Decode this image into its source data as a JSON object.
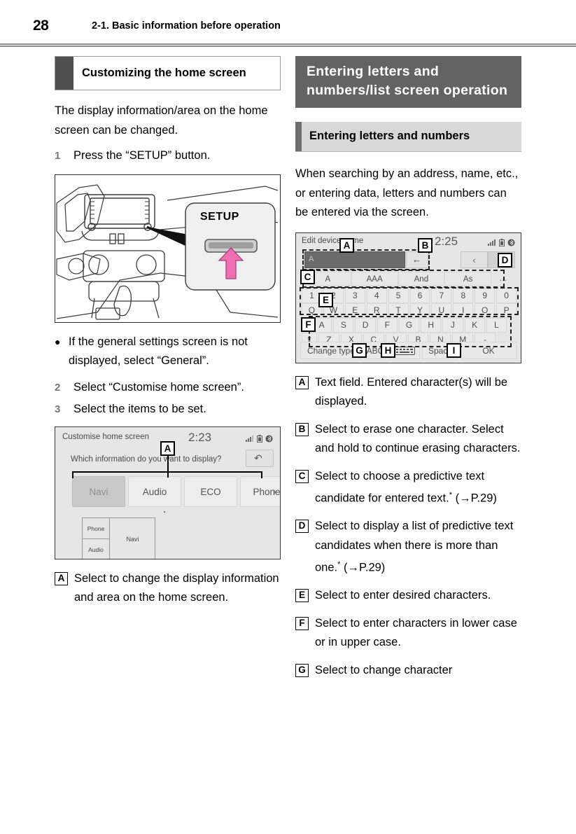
{
  "header": {
    "page_number": "28",
    "breadcrumb": "2-1. Basic information before operation"
  },
  "left_column": {
    "topic_heading": "Customizing the home screen",
    "intro": "The display information/area on the home screen can be changed.",
    "steps": [
      {
        "num": "1",
        "text": "Press the “SETUP” button."
      },
      {
        "num": "2",
        "text": "Select “Customise home screen”."
      },
      {
        "num": "3",
        "text": "Select the items to be set."
      }
    ],
    "bullet": "If the general settings screen is not displayed, select “General”.",
    "figure_setup": {
      "callout_label": "SETUP"
    },
    "screenshot_customise": {
      "title": "Customise home screen",
      "clock": "2:23",
      "question": "Which information do you want to display?",
      "back_icon": "↶",
      "tiles": [
        "Navi",
        "Audio",
        "ECO",
        "Phone"
      ],
      "selected_tile": "Navi",
      "next_arrow": "›",
      "preview": {
        "left_top": "Phone",
        "left_bottom": "Audio",
        "right": "Navi"
      },
      "marker": "A"
    },
    "callouts": [
      {
        "key": "A",
        "text": "Select to change the display information and area on the home screen."
      }
    ]
  },
  "right_column": {
    "section_heading": "Entering letters and numbers/list screen operation",
    "sub_heading": "Entering letters and numbers",
    "intro": "When searching by an address, name, etc., or entering data, letters and numbers can be entered via the screen.",
    "screenshot_keyboard": {
      "title": "Edit device name",
      "clock": "2:25",
      "text_field_value": "A",
      "delete_icon": "←",
      "page_prev": "‹",
      "page_next": "›",
      "candidates": [
        "A",
        "AAA",
        "And",
        "As"
      ],
      "candidates_more": "…",
      "row_numbers": [
        "1",
        "2",
        "3",
        "4",
        "5",
        "6",
        "7",
        "8",
        "9",
        "0"
      ],
      "row_q": [
        "Q",
        "W",
        "E",
        "R",
        "T",
        "Y",
        "U",
        "I",
        "O",
        "P"
      ],
      "row_a": [
        "A",
        "S",
        "D",
        "F",
        "G",
        "H",
        "J",
        "K",
        "L"
      ],
      "row_z": [
        "Z",
        "X",
        "C",
        "V",
        "B",
        "N",
        "M",
        "-"
      ],
      "shift_icon": "⇧",
      "change_type_label": "Change type",
      "abc_label": "ABC",
      "keyboard_icon": "⌨",
      "space_label": "Space",
      "ok_label": "OK",
      "markers": [
        "A",
        "B",
        "C",
        "D",
        "E",
        "F",
        "G",
        "H",
        "I"
      ]
    },
    "callouts": [
      {
        "key": "A",
        "text": "Text field. Entered character(s) will be displayed.",
        "ref": ""
      },
      {
        "key": "B",
        "text": "Select to erase one character. Select and hold to continue erasing characters.",
        "ref": ""
      },
      {
        "key": "C",
        "text": "Select to choose a predictive text candidate for entered text.",
        "star": "*",
        "ref": "(→P.29)"
      },
      {
        "key": "D",
        "text": "Select to display a list of predictive text candidates when there is more than one.",
        "star": "*",
        "ref": "(→P.29)"
      },
      {
        "key": "E",
        "text": "Select to enter desired characters.",
        "ref": ""
      },
      {
        "key": "F",
        "text": "Select to enter characters in lower case or in upper case.",
        "ref": ""
      },
      {
        "key": "G",
        "text": "Select to change character",
        "ref": ""
      }
    ]
  },
  "colors": {
    "section_bg": "#636363",
    "sub_bg": "#d8d8d8",
    "tab_dark": "#4f4f4f",
    "arrow_pink": "#e playlist"
  }
}
